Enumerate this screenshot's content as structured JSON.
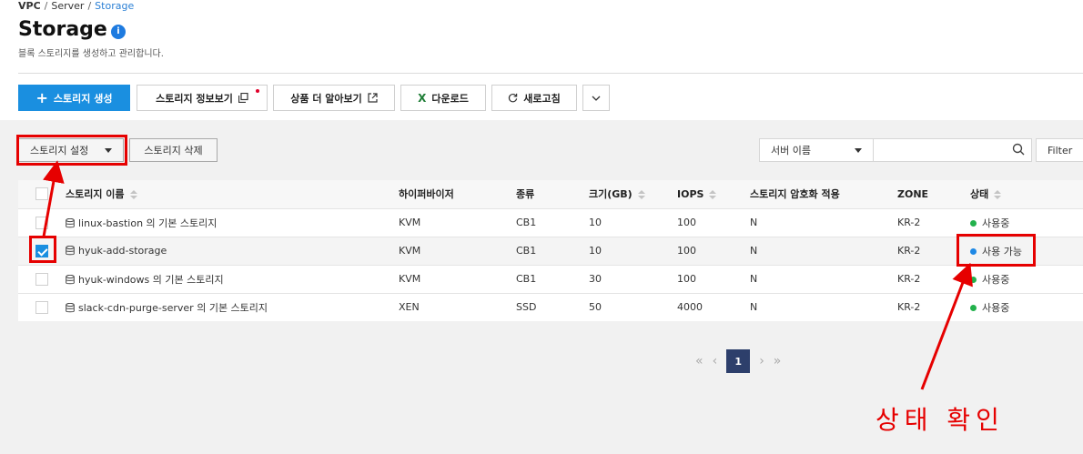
{
  "breadcrumb": [
    "VPC",
    "Server",
    "Storage"
  ],
  "page": {
    "title": "Storage",
    "info_badge": "i",
    "subtitle": "블록 스토리지를 생성하고 관리합니다."
  },
  "toolbar": {
    "create_label": "스토리지 생성",
    "info_label": "스토리지 정보보기",
    "more_label": "상품 더 알아보기",
    "download_label": "다운로드",
    "refresh_label": "새로고침"
  },
  "actions": {
    "settings_label": "스토리지 설정",
    "delete_label": "스토리지 삭제"
  },
  "search": {
    "select_value": "서버 이름",
    "input_value": "",
    "filter_label": "Filter"
  },
  "table": {
    "columns": [
      "스토리지 이름",
      "하이퍼바이저",
      "종류",
      "크기(GB)",
      "IOPS",
      "스토리지 암호화 적용",
      "ZONE",
      "상태"
    ],
    "rows": [
      {
        "checked": false,
        "name": "linux-bastion 의 기본 스토리지",
        "hypervisor": "KVM",
        "type": "CB1",
        "size": "10",
        "iops": "100",
        "encryption": "N",
        "zone": "KR-2",
        "status": "사용중",
        "status_color": "#22b14c"
      },
      {
        "checked": true,
        "name": "hyuk-add-storage",
        "hypervisor": "KVM",
        "type": "CB1",
        "size": "10",
        "iops": "100",
        "encryption": "N",
        "zone": "KR-2",
        "status": "사용 가능",
        "status_color": "#1e88e5"
      },
      {
        "checked": false,
        "name": "hyuk-windows 의 기본 스토리지",
        "hypervisor": "KVM",
        "type": "CB1",
        "size": "30",
        "iops": "100",
        "encryption": "N",
        "zone": "KR-2",
        "status": "사용중",
        "status_color": "#22b14c"
      },
      {
        "checked": false,
        "name": "slack-cdn-purge-server 의 기본 스토리지",
        "hypervisor": "XEN",
        "type": "SSD",
        "size": "50",
        "iops": "4000",
        "encryption": "N",
        "zone": "KR-2",
        "status": "사용중",
        "status_color": "#22b14c"
      }
    ]
  },
  "pagination": {
    "current": "1",
    "first": "«",
    "prev": "‹",
    "next": "›",
    "last": "»"
  },
  "annotation": {
    "note": "상태 확인",
    "color": "#e60000"
  }
}
